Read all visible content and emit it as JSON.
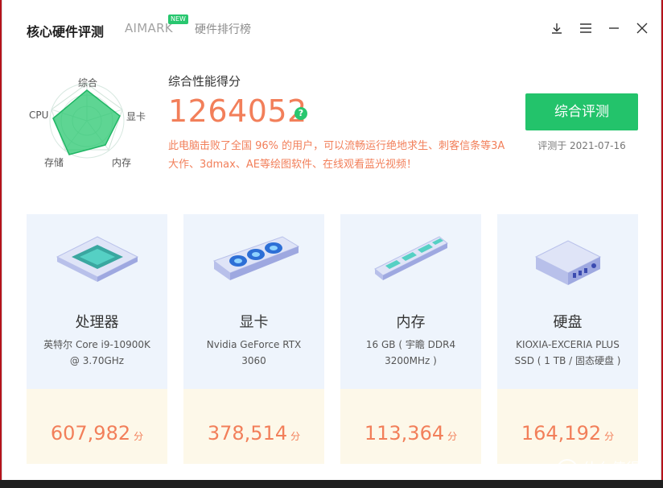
{
  "header": {
    "tabs": [
      {
        "label": "核心硬件评测",
        "active": true
      },
      {
        "label": "AIMARK",
        "badge": "NEW"
      },
      {
        "label": "硬件排行榜"
      }
    ],
    "icons": [
      "download-icon",
      "menu-icon",
      "minimize-icon",
      "close-icon"
    ]
  },
  "radar": {
    "labels": {
      "top": "综合",
      "right": "显卡",
      "bottom_right": "内存",
      "bottom_left": "存储",
      "left": "CPU"
    }
  },
  "score": {
    "title": "综合性能得分",
    "value": "1264052",
    "help": "?",
    "description": "此电脑击败了全国 96% 的用户，可以流畅运行绝地求生、刺客信条等3A大作、3dmax、AE等绘图软件、在线观看蓝光视频！",
    "button": "综合评测",
    "date": "评测于 2021-07-16"
  },
  "cards": [
    {
      "name": "处理器",
      "model": "英特尔 Core i9-10900K @ 3.70GHz",
      "score": "607,982",
      "unit": "分"
    },
    {
      "name": "显卡",
      "model": "Nvidia GeForce RTX 3060",
      "score": "378,514",
      "unit": "分"
    },
    {
      "name": "内存",
      "model": "16 GB ( 宇瞻 DDR4 3200MHz )",
      "score": "113,364",
      "unit": "分"
    },
    {
      "name": "硬盘",
      "model": "KIOXIA-EXCERIA PLUS SSD ( 1 TB / 固态硬盘 )",
      "score": "164,192",
      "unit": "分"
    }
  ],
  "colors": {
    "accent_green": "#23c36b",
    "score_orange": "#f27f5a"
  },
  "watermark": "什么值得买"
}
